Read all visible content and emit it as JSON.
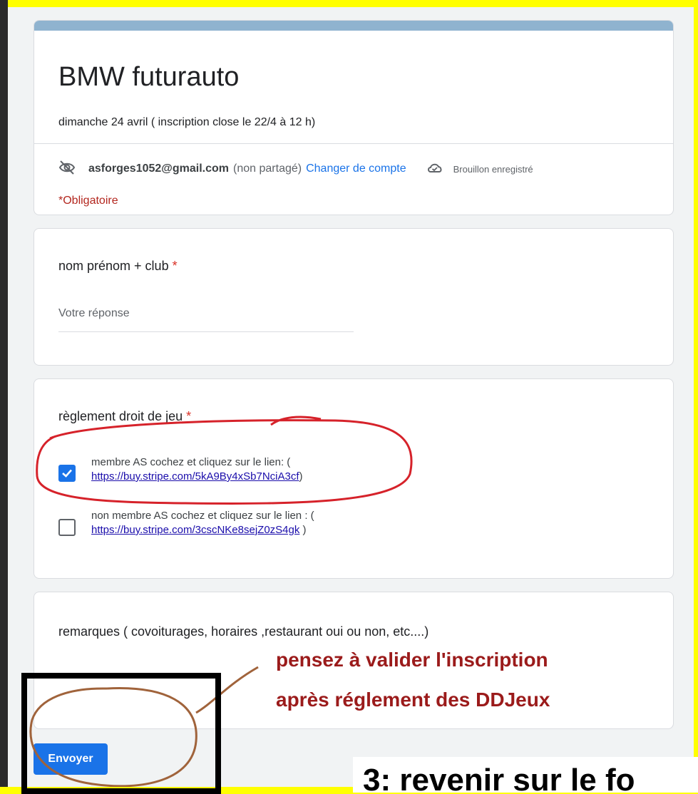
{
  "form": {
    "title": "BMW futurauto",
    "description": "dimanche 24 avril ( inscription close le 22/4 à 12 h)",
    "account_email": "asforges1052@gmail.com",
    "not_shared": "(non partagé)",
    "switch_account": "Changer de compte",
    "draft_saved": "Brouillon enregistré",
    "required_note": "*Obligatoire"
  },
  "q_name": {
    "title": "nom prénom + club",
    "required_mark": "*",
    "placeholder": "Votre réponse"
  },
  "q_rules": {
    "title": "règlement droit de jeu",
    "required_mark": "*",
    "options": [
      {
        "line1": "membre AS cochez et cliquez sur le lien: (",
        "link": "https://buy.stripe.com/5kA9By4xSb7NciA3cf",
        "suffix": ")",
        "checked": true
      },
      {
        "line1": "non membre AS cochez et cliquez sur le lien : (",
        "link": "https://buy.stripe.com/3cscNKe8sejZ0zS4gk",
        "suffix": " )",
        "checked": false
      }
    ]
  },
  "q_remarks": {
    "title": "remarques ( covoiturages, horaires ,restaurant oui ou non, etc....)"
  },
  "submit_label": "Envoyer",
  "annotations": {
    "line1": "pensez à valider l'inscription",
    "line2": "après réglement des DDJeux",
    "bottom_banner": "3: revenir sur le fo"
  },
  "colors": {
    "background": "#ffff00",
    "accent": "#1a73e8",
    "required": "#d93025",
    "annotation_red": "#9b1b1b"
  }
}
